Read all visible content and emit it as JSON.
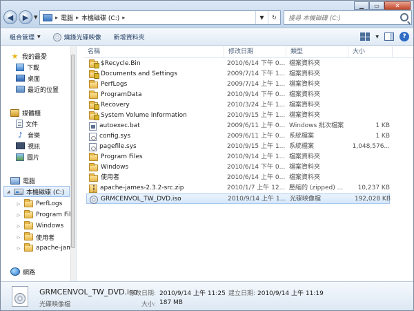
{
  "address": {
    "crumbs": [
      "電腦",
      "本機磁碟 (C:)"
    ],
    "search_placeholder": "搜尋 本機磁碟 (C:)"
  },
  "toolbar": {
    "organize": "組合管理",
    "burn": "燒錄光碟映像",
    "new_folder": "新增資料夾"
  },
  "nav": {
    "favorites": "我的最愛",
    "downloads": "下載",
    "desktop": "桌面",
    "recent": "最近的位置",
    "libraries": "媒體櫃",
    "documents": "文件",
    "music": "音樂",
    "videos": "視訊",
    "pictures": "圖片",
    "computer": "電腦",
    "local_disk": "本機磁碟 (C:)",
    "sub_items": [
      "PerfLogs",
      "Program Files",
      "Windows",
      "使用者",
      "apache-james"
    ],
    "network": "網路"
  },
  "columns": {
    "name": "名稱",
    "date": "修改日期",
    "type": "類型",
    "size": "大小"
  },
  "files": [
    {
      "name": "$Recycle.Bin",
      "date": "2010/6/14 下午 0...",
      "type": "檔案資料夾",
      "size": "",
      "icon": "folder-lock-icon"
    },
    {
      "name": "Documents and Settings",
      "date": "2009/7/14 下午 1...",
      "type": "檔案資料夾",
      "size": "",
      "icon": "folder-lock-icon"
    },
    {
      "name": "PerfLogs",
      "date": "2009/7/14 上午 1...",
      "type": "檔案資料夾",
      "size": "",
      "icon": "folder-icon"
    },
    {
      "name": "ProgramData",
      "date": "2010/9/14 下午 0...",
      "type": "檔案資料夾",
      "size": "",
      "icon": "folder-icon"
    },
    {
      "name": "Recovery",
      "date": "2010/3/24 上午 1...",
      "type": "檔案資料夾",
      "size": "",
      "icon": "folder-lock-icon"
    },
    {
      "name": "System Volume Information",
      "date": "2010/9/15 上午 1...",
      "type": "檔案資料夾",
      "size": "",
      "icon": "folder-lock-icon"
    },
    {
      "name": "autoexec.bat",
      "date": "2009/6/11 上午 0...",
      "type": "Windows 批次檔案",
      "size": "1 KB",
      "icon": "batch-file-icon"
    },
    {
      "name": "config.sys",
      "date": "2009/6/11 上午 0...",
      "type": "系統檔案",
      "size": "1 KB",
      "icon": "system-file-icon"
    },
    {
      "name": "pagefile.sys",
      "date": "2010/9/15 上午 1...",
      "type": "系統檔案",
      "size": "1,048,576...",
      "icon": "system-file-icon"
    },
    {
      "name": "Program Files",
      "date": "2010/9/14 上午 1...",
      "type": "檔案資料夾",
      "size": "",
      "icon": "folder-icon"
    },
    {
      "name": "Windows",
      "date": "2010/6/14 下午 0...",
      "type": "檔案資料夾",
      "size": "",
      "icon": "folder-icon"
    },
    {
      "name": "使用者",
      "date": "2010/6/14 上午 0...",
      "type": "檔案資料夾",
      "size": "",
      "icon": "folder-icon"
    },
    {
      "name": "apache-james-2.3.2-src.zip",
      "date": "2010/1/7 上午 12...",
      "type": "壓縮的 (zipped) ...",
      "size": "10,237 KB",
      "icon": "zip-file-icon"
    },
    {
      "name": "GRMCENVOL_TW_DVD.iso",
      "date": "2010/9/14 上午 1...",
      "type": "光碟映像檔",
      "size": "192,028 KB",
      "icon": "disc-image-icon"
    }
  ],
  "selected_index": 13,
  "details": {
    "name": "GRMCENVOL_TW_DVD.iso",
    "type": "光碟映像檔",
    "modified_label": "修改日期:",
    "modified_value": "2010/9/14 上午 11:25",
    "created_label": "建立日期:",
    "created_value": "2010/9/14 上午 11:19",
    "size_label": "大小:",
    "size_value": "187 MB"
  }
}
